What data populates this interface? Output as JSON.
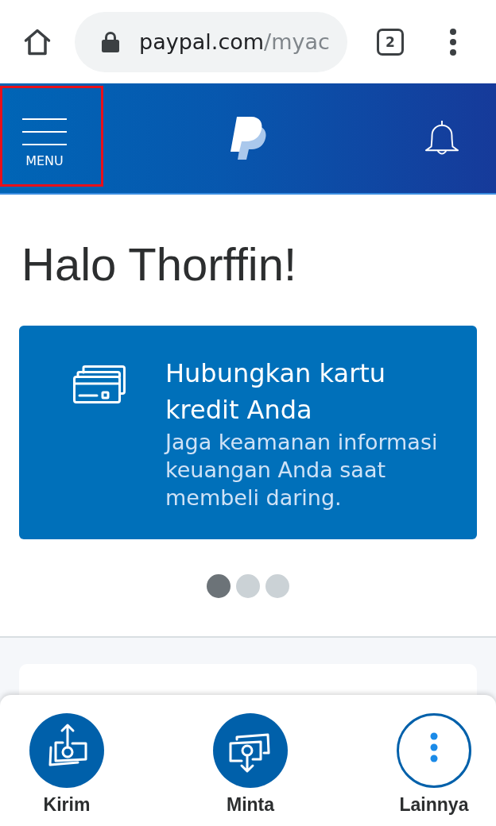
{
  "browser": {
    "url_host": "paypal.com",
    "url_path": "/myac",
    "tab_count": "2"
  },
  "header": {
    "menu_label": "MENU",
    "menu_highlighted": true
  },
  "greeting": "Halo Thorffin!",
  "promo_card": {
    "title": "Hubungkan kartu kredit Anda",
    "description": "Jaga keamanan informasi keuangan Anda saat membeli daring."
  },
  "carousel_dots": [
    {
      "selected": true
    },
    {
      "selected": false
    },
    {
      "selected": false
    }
  ],
  "actions": [
    {
      "kind": "send",
      "label": "Kirim"
    },
    {
      "kind": "request",
      "label": "Minta"
    },
    {
      "kind": "more",
      "label": "Lainnya"
    }
  ]
}
